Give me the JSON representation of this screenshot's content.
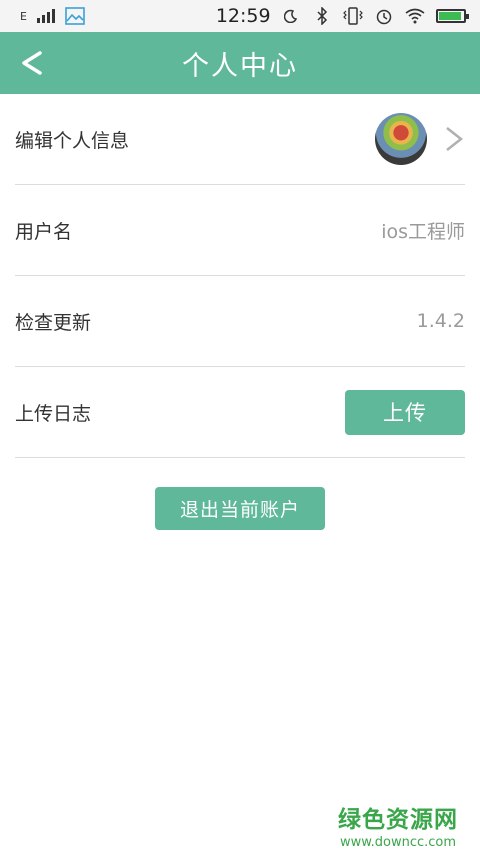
{
  "status_bar": {
    "network_type": "E",
    "time": "12:59",
    "signal_icon": "signal-bars-icon",
    "gallery_icon": "image-icon",
    "moon_icon": "moon-icon",
    "bluetooth_icon": "bluetooth-icon",
    "vibrate_icon": "vibrate-icon",
    "alarm_icon": "alarm-icon",
    "wifi_icon": "wifi-icon",
    "battery_icon": "battery-icon",
    "battery_level_percent": 90
  },
  "header": {
    "title": "个人中心",
    "back_icon": "back-arrow-icon",
    "accent_color": "#5fb89a"
  },
  "list": {
    "items": [
      {
        "label": "编辑个人信息",
        "avatar_icon": "avatar-image",
        "chevron_icon": "chevron-right-icon"
      },
      {
        "label": "用户名",
        "value": "ios工程师"
      },
      {
        "label": "检查更新",
        "value": "1.4.2"
      },
      {
        "label": "上传日志",
        "button_label": "上传"
      }
    ]
  },
  "logout_button_label": "退出当前账户",
  "watermark": {
    "logo_text": "绿色资源网",
    "url": "www.downcc.com",
    "color": "#3aa64a"
  }
}
